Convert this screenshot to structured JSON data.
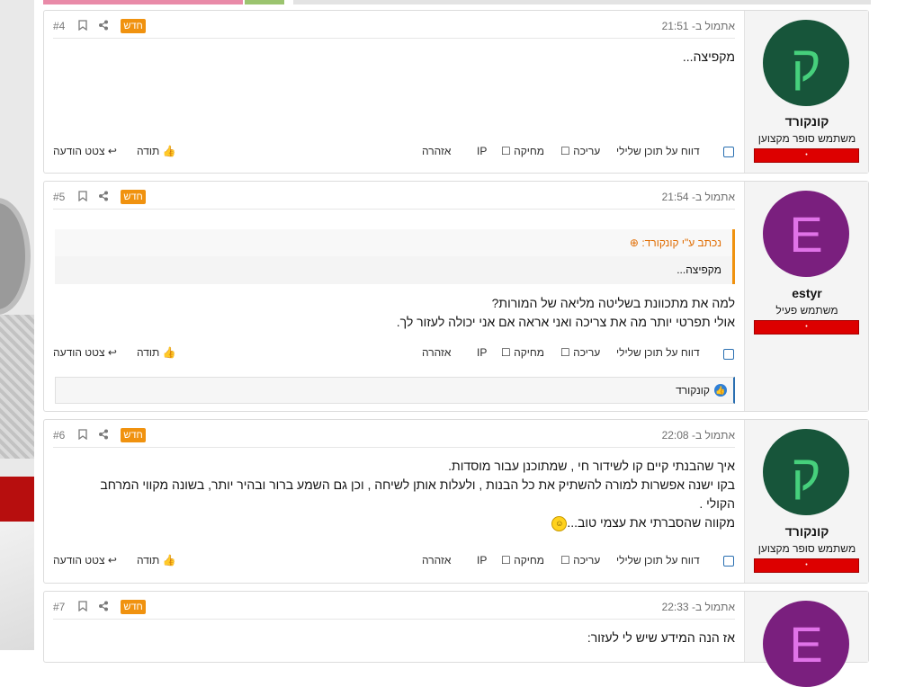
{
  "actions": {
    "report": "דווח על תוכן שלילי",
    "edit": "עריכה",
    "delete": "מחיקה",
    "ip": "IP",
    "warn": "אזהרה",
    "thanks": "תודה",
    "quote": "צטט הודעה"
  },
  "badge_new": "חדש",
  "icons": {
    "bookmark": "bookmark-icon",
    "share": "share-icon",
    "thumbs_up": "thumbs-up-icon",
    "reply_arrow": "reply-icon",
    "quote_arrow": "arrow-up-circle-icon",
    "like_reaction": "like-reaction-icon",
    "emoji": "smiley-icon"
  },
  "colors": {
    "new_badge": "#f0920f",
    "quote_accent": "#f0920f",
    "user_bar": "#dd0000",
    "link": "#2a6fb1"
  },
  "posts": [
    {
      "number": "#4",
      "timestamp": "אתמול ב- 21:51",
      "author": {
        "name": "קונקורד",
        "title": "משתמש סופר מקצוען",
        "avatar_letter": "ק",
        "avatar_bg": "#17553a",
        "avatar_fg": "#46d07c",
        "bar": "•"
      },
      "body": [
        "מקפיצה..."
      ]
    },
    {
      "number": "#5",
      "timestamp": "אתמול ב- 21:54",
      "author": {
        "name": "estyr",
        "title": "משתמש פעיל",
        "avatar_letter": "E",
        "avatar_bg": "#7a1f7e",
        "avatar_fg": "#e073e8",
        "bar": "•"
      },
      "quote": {
        "header": "נכתב ע\"י קונקורד:",
        "text": "מקפיצה..."
      },
      "body": [
        "למה את מתכוונת בשליטה מליאה של המורות?",
        "אולי תפרטי יותר מה את צריכה ואני אראה אם אני יכולה לעזור לך."
      ],
      "reaction": "קונקורד"
    },
    {
      "number": "#6",
      "timestamp": "אתמול ב- 22:08",
      "author": {
        "name": "קונקורד",
        "title": "משתמש סופר מקצוען",
        "avatar_letter": "ק",
        "avatar_bg": "#17553a",
        "avatar_fg": "#46d07c",
        "bar": "•"
      },
      "body": [
        "איך שהבנתי קיים קו לשידור חי , שמתוכנן עבור מוסדות.",
        "בקו ישנה אפשרות למורה להשתיק את כל הבנות , ולעלות אותן לשיחה , וכן גם השמע ברור ובהיר יותר, בשונה מקווי המרחב",
        "הקולי .",
        "מקווה שהסברתי את עצמי טוב..."
      ]
    },
    {
      "number": "#7",
      "timestamp": "אתמול ב- 22:33",
      "author": {
        "avatar_letter": "E",
        "avatar_bg": "#7a1f7e",
        "avatar_fg": "#e073e8"
      },
      "body": [
        "אז הנה המידע שיש לי לעזור:"
      ]
    }
  ]
}
